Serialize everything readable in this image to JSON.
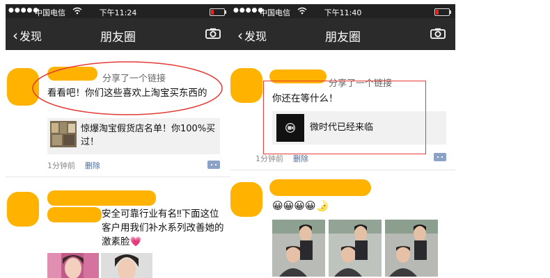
{
  "screens": [
    {
      "status_bar": {
        "dots": "●●●●●",
        "carrier": "中国电信",
        "time": "下午11:24"
      },
      "nav": {
        "back_label": "发现",
        "title": "朋友圈"
      },
      "posts": [
        {
          "share_label": "分享了一个链接",
          "text": "看看吧！你们这些喜欢上淘宝买东西的",
          "link_title": "惊爆淘宝假货店名单！你100%买过！",
          "time": "1分钟前",
          "delete_label": "删除"
        },
        {
          "text": "安全可靠行业有名‼下面这位客户用我们补水系列改善她的激素脸💗"
        }
      ]
    },
    {
      "status_bar": {
        "dots": "●●●●●",
        "carrier": "中国电信",
        "time": "下午11:40"
      },
      "nav": {
        "back_label": "发现",
        "title": "朋友圈"
      },
      "posts": [
        {
          "share_label": "分享了一个链接",
          "text": "你还在等什么！",
          "link_title": "微时代已经来临",
          "time": "1分钟前",
          "delete_label": "删除"
        },
        {
          "emojis": "😀😀😀😀🌛"
        }
      ]
    }
  ],
  "colors": {
    "nav_bg": "#2b2b2b",
    "blur_blob": "#ffb300",
    "annotation": "#e53935",
    "link_card_bg": "#f1f1f1",
    "delete_link": "#4a6a9a"
  },
  "icons": [
    "wifi-icon",
    "battery-icon",
    "back-chevron-icon",
    "camera-icon",
    "comment-icon",
    "video-icon"
  ]
}
